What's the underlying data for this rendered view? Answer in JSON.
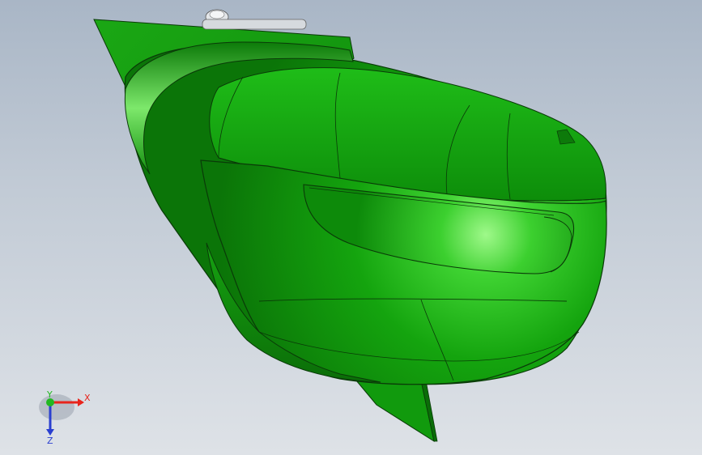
{
  "viewport": {
    "background_top": "#a9b6c6",
    "background_bottom": "#dee2e7"
  },
  "model": {
    "body_color": "#14a010",
    "highlight_color": "#7ef46a",
    "edge_color": "#0a3a08",
    "hardware_color": "#d4d8dc"
  },
  "triad": {
    "x_label": "X",
    "y_label": "Y",
    "z_label": "Z",
    "x_color": "#e8241c",
    "y_color": "#22b821",
    "z_color": "#2a3fd0"
  }
}
